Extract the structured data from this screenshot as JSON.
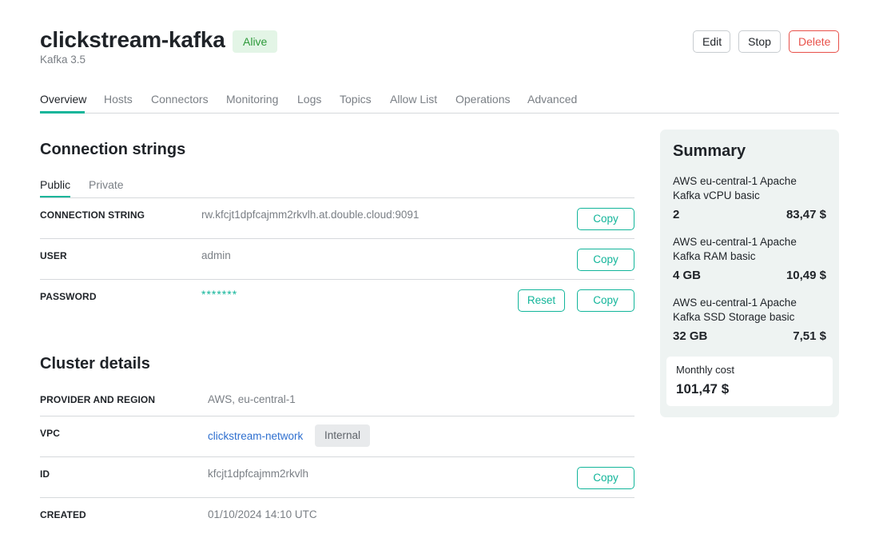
{
  "header": {
    "title": "clickstream-kafka",
    "status": "Alive",
    "subtitle": "Kafka 3.5",
    "buttons": {
      "edit": "Edit",
      "stop": "Stop",
      "delete": "Delete"
    }
  },
  "tabs": [
    "Overview",
    "Hosts",
    "Connectors",
    "Monitoring",
    "Logs",
    "Topics",
    "Allow List",
    "Operations",
    "Advanced"
  ],
  "connection": {
    "heading": "Connection strings",
    "subtabs": [
      "Public",
      "Private"
    ],
    "rows": {
      "connection_string": {
        "label": "CONNECTION STRING",
        "value": "rw.kfcjt1dpfcajmm2rkvlh.at.double.cloud:9091",
        "copy": "Copy"
      },
      "user": {
        "label": "USER",
        "value": "admin",
        "copy": "Copy"
      },
      "password": {
        "label": "PASSWORD",
        "value": "*******",
        "reset": "Reset",
        "copy": "Copy"
      }
    }
  },
  "cluster": {
    "heading": "Cluster details",
    "rows": {
      "provider": {
        "label": "PROVIDER AND REGION",
        "value": "AWS, eu-central-1"
      },
      "vpc": {
        "label": "VPC",
        "value": "clickstream-network",
        "tag": "Internal"
      },
      "id": {
        "label": "ID",
        "value": "kfcjt1dpfcajmm2rkvlh",
        "copy": "Copy"
      },
      "created": {
        "label": "CREATED",
        "value": "01/10/2024 14:10 UTC"
      }
    }
  },
  "summary": {
    "title": "Summary",
    "items": [
      {
        "name": "AWS eu-central-1 Apache Kafka vCPU basic",
        "qty": "2",
        "price": "83,47 $"
      },
      {
        "name": "AWS eu-central-1 Apache Kafka RAM basic",
        "qty": "4 GB",
        "price": "10,49 $"
      },
      {
        "name": "AWS eu-central-1 Apache Kafka SSD Storage basic",
        "qty": "32 GB",
        "price": "7,51 $"
      }
    ],
    "monthly_label": "Monthly cost",
    "monthly_value": "101,47 $"
  },
  "colors": {
    "accent": "#12b59a",
    "alive_bg": "#e3f5e6",
    "alive_text": "#2e9a3a",
    "danger": "#e8514a",
    "link": "#2e6fcf",
    "summary_bg": "#eef3f2"
  }
}
